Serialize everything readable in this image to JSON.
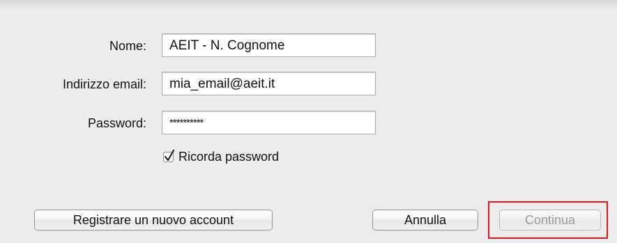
{
  "form": {
    "name_label": "Nome:",
    "name_value": "AEIT - N. Cognome",
    "email_label": "Indirizzo email:",
    "email_value": "mia_email@aeit.it",
    "password_label": "Password:",
    "password_value": "**********",
    "remember_label": "Ricorda password",
    "remember_checked": true
  },
  "buttons": {
    "register_label": "Registrare un nuovo account",
    "cancel_label": "Annulla",
    "continue_label": "Continua",
    "continue_enabled": false
  },
  "colors": {
    "highlight": "#e8141c",
    "window_bg": "#ececec"
  }
}
